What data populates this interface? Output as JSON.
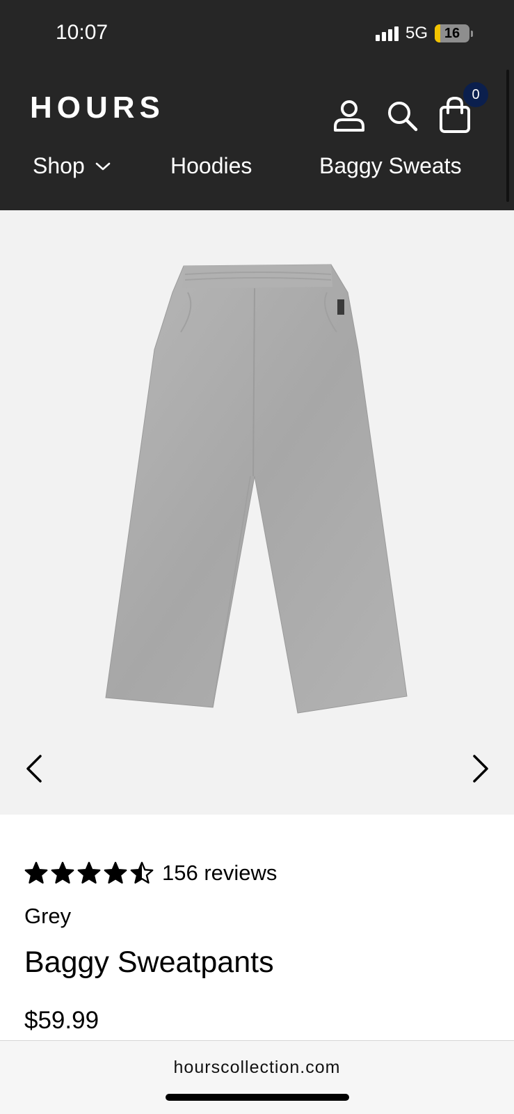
{
  "status_bar": {
    "time": "10:07",
    "network": "5G",
    "battery": "16",
    "battery_level": 0.16
  },
  "header": {
    "logo": "HOURS",
    "icons": {
      "account": "account-icon",
      "search": "search-icon",
      "cart": "shopping-bag-icon"
    },
    "cart_count": "0",
    "nav": [
      {
        "label": "Shop",
        "icon": "chevron-down-icon"
      },
      {
        "label": "Hoodies"
      },
      {
        "label": "Baggy Sweats"
      }
    ]
  },
  "gallery": {
    "prev_icon": "chevron-left-icon",
    "next_icon": "chevron-right-icon"
  },
  "product": {
    "rating": 4.5,
    "rating_max": 5,
    "reviews": "156 reviews",
    "color": "Grey",
    "title": "Baggy Sweatpants",
    "price": "$59.99"
  },
  "browser": {
    "domain": "hourscollection.com"
  },
  "colors": {
    "header_bg": "#262626",
    "gallery_bg": "#f2f2f2",
    "badge_bg": "#0b1f4d",
    "battery": "#f3c400"
  }
}
